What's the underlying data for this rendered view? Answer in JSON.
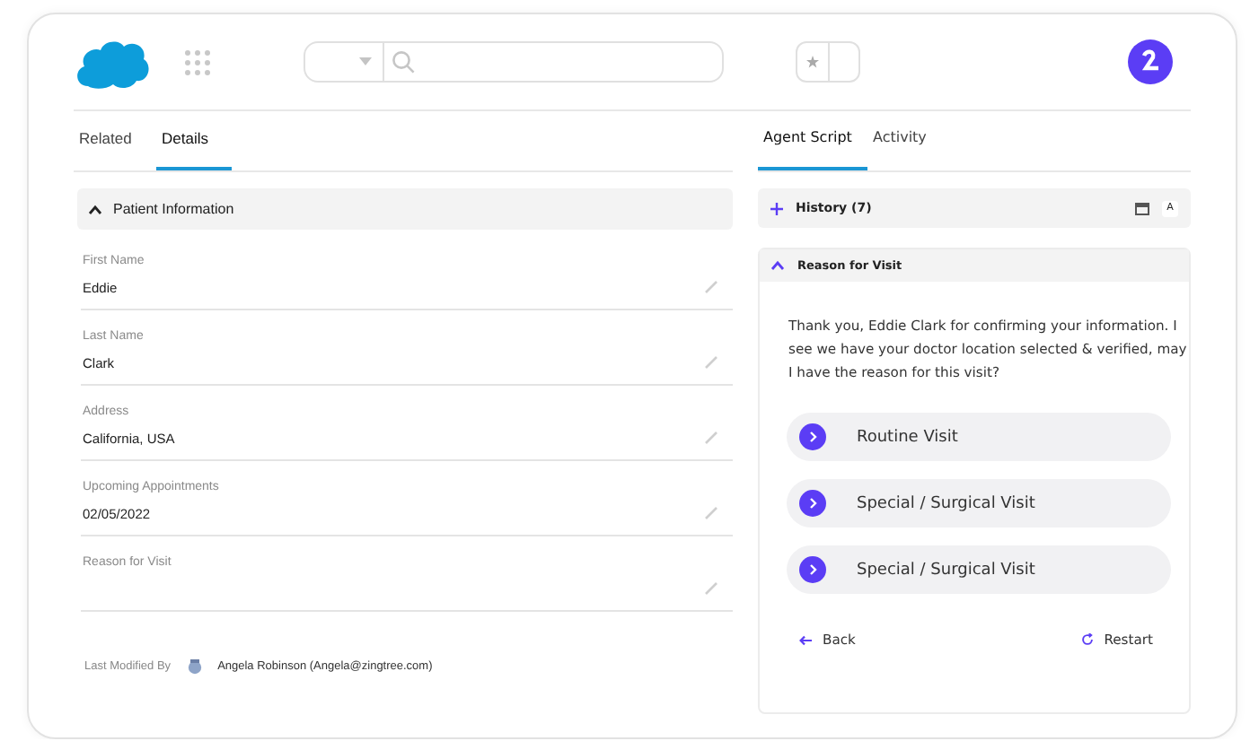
{
  "left_tabs": [
    {
      "label": "Related",
      "selected": false
    },
    {
      "label": "Details",
      "selected": true
    }
  ],
  "patient_section": {
    "title": "Patient Information",
    "expanded": true
  },
  "fields": [
    {
      "label": "First Name",
      "value": "Eddie"
    },
    {
      "label": "Last Name",
      "value": "Clark"
    },
    {
      "label": "Address",
      "value": "California, USA"
    },
    {
      "label": "Upcoming Appointments",
      "value": "02/05/2022"
    },
    {
      "label": "Reason for Visit"
    }
  ],
  "last_modified": {
    "label": "Last Modified By",
    "user": "Angela Robinson (Angela@zingtree.com)"
  },
  "right_tabs": [
    {
      "label": "Agent Script",
      "selected": true
    },
    {
      "label": "Activity",
      "selected": false
    }
  ],
  "history": {
    "title": "History (7)",
    "expanded": false,
    "font_button": "A"
  },
  "script": {
    "title": "Reason for Visit",
    "expanded": true,
    "message": "Thank you, Eddie Clark for confirming your information. I see we have your doctor location selected & verified, may I have the reason for this visit?",
    "options": [
      {
        "label": "Routine Visit"
      },
      {
        "label": "Special / Surgical Visit"
      },
      {
        "label": "Special / Surgical Visit"
      }
    ],
    "back": "Back",
    "restart": "Restart"
  }
}
